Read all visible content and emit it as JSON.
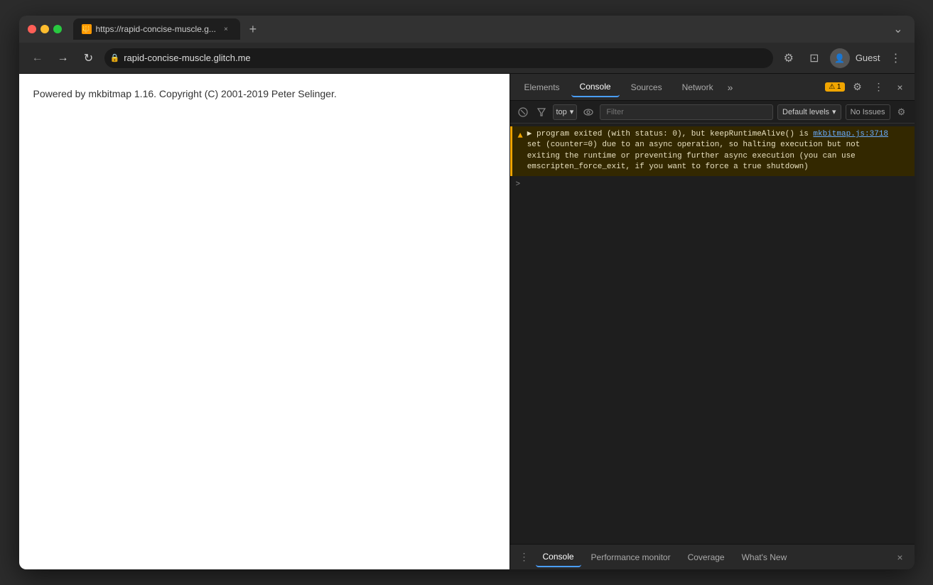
{
  "browser": {
    "tab_url": "https://rapid-concise-muscle.g...",
    "tab_url_full": "https://rapid-concise-muscle.glitch.me",
    "address_bar_url": "rapid-concise-muscle.glitch.me",
    "tab_close_label": "×",
    "new_tab_label": "+",
    "dropdown_label": "⌄",
    "nav_back": "←",
    "nav_forward": "→",
    "nav_refresh": "↻",
    "profile_label": "Guest",
    "more_label": "⋮"
  },
  "webpage": {
    "content": "Powered by mkbitmap 1.16. Copyright (C) 2001-2019 Peter Selinger."
  },
  "devtools": {
    "tabs": [
      {
        "label": "Elements",
        "active": false
      },
      {
        "label": "Console",
        "active": true
      },
      {
        "label": "Sources",
        "active": false
      },
      {
        "label": "Network",
        "active": false
      }
    ],
    "tabs_more": "»",
    "warning_badge": "⚠ 1",
    "settings_icon": "⚙",
    "more_icon": "⋮",
    "close_icon": "×",
    "console_toolbar": {
      "clear_icon": "🚫",
      "filter_placeholder": "Filter",
      "context_label": "top",
      "context_arrow": "▾",
      "eye_icon": "👁",
      "levels_label": "Default levels",
      "levels_arrow": "▾",
      "no_issues_label": "No Issues",
      "settings_icon": "⚙"
    },
    "console_messages": [
      {
        "type": "warning",
        "icon": "▲",
        "prefix": "▶",
        "text": "program exited (with status: 0), but keepRuntimeAlive() is ",
        "link": "mkbitmap.js:3718",
        "continuation": "\nset (counter=0) due to an async operation, so halting execution but not\nexiting the runtime or preventing further async execution (you can use\nemscripten_force_exit, if you want to force a true shutdown)"
      }
    ],
    "console_prompt": {
      "arrow": ">"
    },
    "bottom_tabs": [
      {
        "label": "Console",
        "active": true
      },
      {
        "label": "Performance monitor",
        "active": false
      },
      {
        "label": "Coverage",
        "active": false
      },
      {
        "label": "What's New",
        "active": false
      }
    ],
    "bottom_icon": "⋮",
    "bottom_close": "×"
  }
}
